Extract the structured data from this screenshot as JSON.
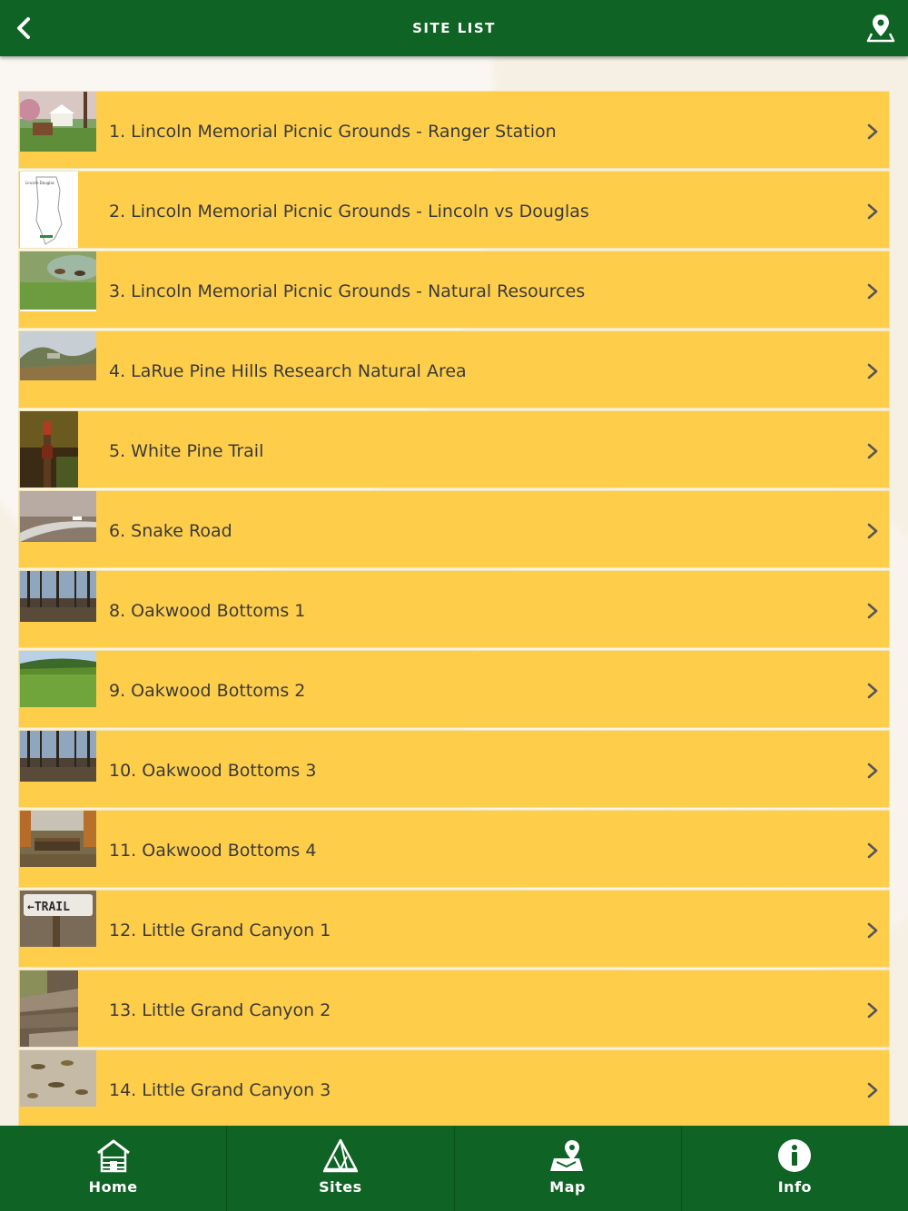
{
  "header": {
    "title": "SITE LIST",
    "back_icon": "chevron-left-icon",
    "map_icon": "location-pin-icon"
  },
  "sites": [
    {
      "label": "1. Lincoln Memorial Picnic Grounds - Ranger Station",
      "thumb": "lodge"
    },
    {
      "label": "2. Lincoln Memorial Picnic Grounds - Lincoln vs Douglas",
      "thumb": "map"
    },
    {
      "label": "3. Lincoln Memorial Picnic Grounds - Natural Resources",
      "thumb": "pond"
    },
    {
      "label": "4. LaRue Pine Hills Research Natural Area",
      "thumb": "bluffs"
    },
    {
      "label": "5. White Pine Trail",
      "thumb": "sign"
    },
    {
      "label": "6. Snake Road",
      "thumb": "road"
    },
    {
      "label": "8. Oakwood Bottoms 1",
      "thumb": "woods"
    },
    {
      "label": "9. Oakwood Bottoms 2",
      "thumb": "meadow"
    },
    {
      "label": "10. Oakwood Bottoms 3",
      "thumb": "woods"
    },
    {
      "label": "11. Oakwood Bottoms 4",
      "thumb": "bridge"
    },
    {
      "label": "12. Little Grand Canyon 1",
      "thumb": "trailsign",
      "thumb_text": "←TRAIL"
    },
    {
      "label": "13. Little Grand Canyon 2",
      "thumb": "canyon"
    },
    {
      "label": "14. Little Grand Canyon 3",
      "thumb": "leaves"
    },
    {
      "label": "",
      "thumb": "partial"
    }
  ],
  "tabbar": [
    {
      "label": "Home",
      "icon": "cabin-icon"
    },
    {
      "label": "Sites",
      "icon": "tent-icon"
    },
    {
      "label": "Map",
      "icon": "map-pin-icon"
    },
    {
      "label": "Info",
      "icon": "info-icon"
    }
  ],
  "colors": {
    "primary_green": "#0f6324",
    "row_yellow": "#fece4b",
    "text": "#3a3a3a"
  }
}
